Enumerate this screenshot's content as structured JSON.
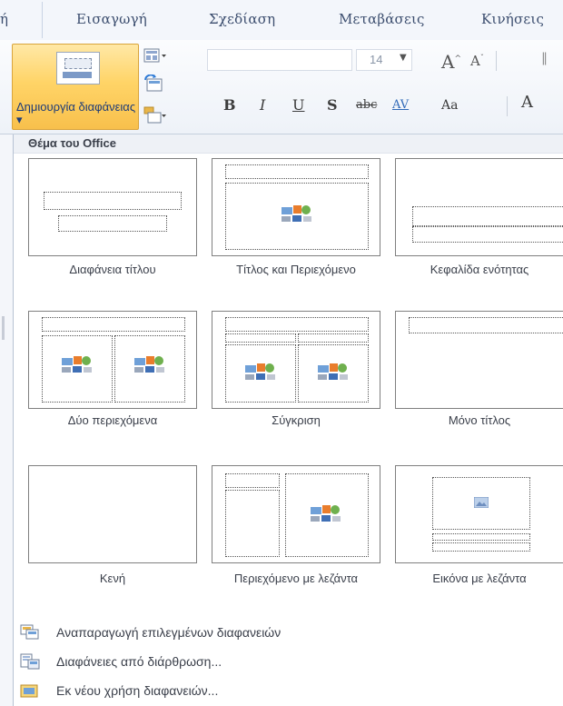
{
  "ribbon": {
    "tabs": [
      "ή",
      "Εισαγωγή",
      "Σχεδίαση",
      "Μεταβάσεις",
      "Κινήσεις"
    ],
    "new_slide_label": "Δημιουργία διαφάνειας ▾",
    "font_size": "14",
    "format_buttons": [
      "B",
      "I",
      "U",
      "S",
      "abc",
      "AV",
      "Aa",
      "A"
    ]
  },
  "gallery": {
    "section_title": "Θέμα του Office",
    "layouts": [
      {
        "label": "Διαφάνεια τίτλου"
      },
      {
        "label": "Τίτλος και Περιεχόμενο"
      },
      {
        "label": "Κεφαλίδα ενότητας"
      },
      {
        "label": "Δύο περιεχόμενα"
      },
      {
        "label": "Σύγκριση"
      },
      {
        "label": "Μόνο τίτλος"
      },
      {
        "label": "Κενή"
      },
      {
        "label": "Περιεχόμενο με λεζάντα"
      },
      {
        "label": "Εικόνα με λεζάντα"
      }
    ]
  },
  "menu": {
    "items": [
      {
        "label": "Αναπαραγωγή επιλεγμένων διαφανειών",
        "icon": "duplicate-slides-icon"
      },
      {
        "label": "Διαφάνειες από διάρθρωση...",
        "icon": "outline-slides-icon"
      },
      {
        "label": "Εκ νέου χρήση διαφανειών...",
        "icon": "reuse-slides-icon"
      }
    ]
  },
  "colors": {
    "accent": "#f8c04c",
    "tab_text": "#3b4d6e",
    "ribbon_bg": "#eef2f8"
  }
}
